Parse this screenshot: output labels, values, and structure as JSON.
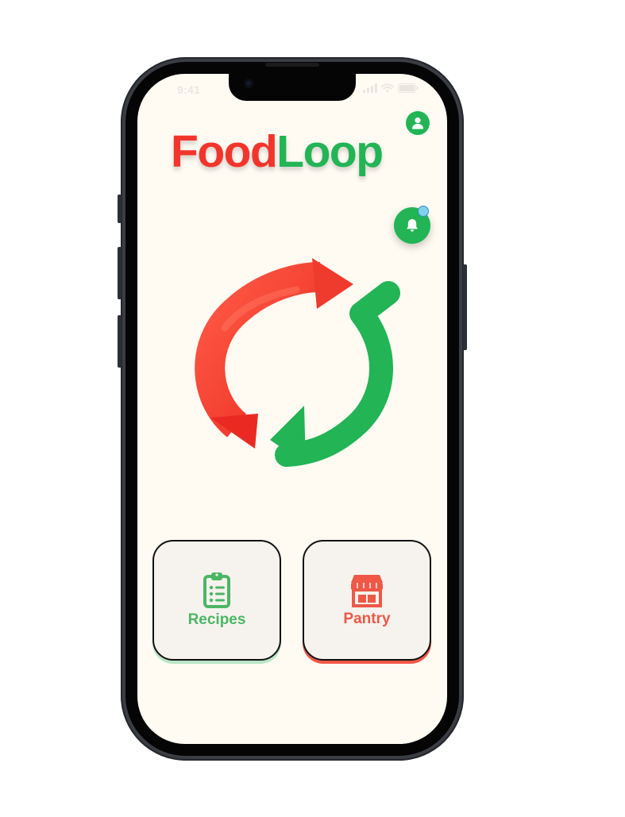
{
  "status_bar": {
    "time": "9:41"
  },
  "header": {
    "logo_part1": "Food",
    "logo_part2": "Loop",
    "profile_icon": "user-icon",
    "notification_icon": "bell-icon"
  },
  "hero": {
    "graphic": "recycle-arrows-icon"
  },
  "cards": {
    "recipes": {
      "label": "Recipes",
      "icon": "clipboard-list-icon",
      "color": "#4cb665"
    },
    "pantry": {
      "label": "Pantry",
      "icon": "storefront-icon",
      "color": "#ef5847"
    }
  },
  "colors": {
    "brand_red": "#f2352c",
    "brand_green": "#22b455",
    "screen_bg": "#fffbf3",
    "notification_dot": "#7fd1ee"
  }
}
